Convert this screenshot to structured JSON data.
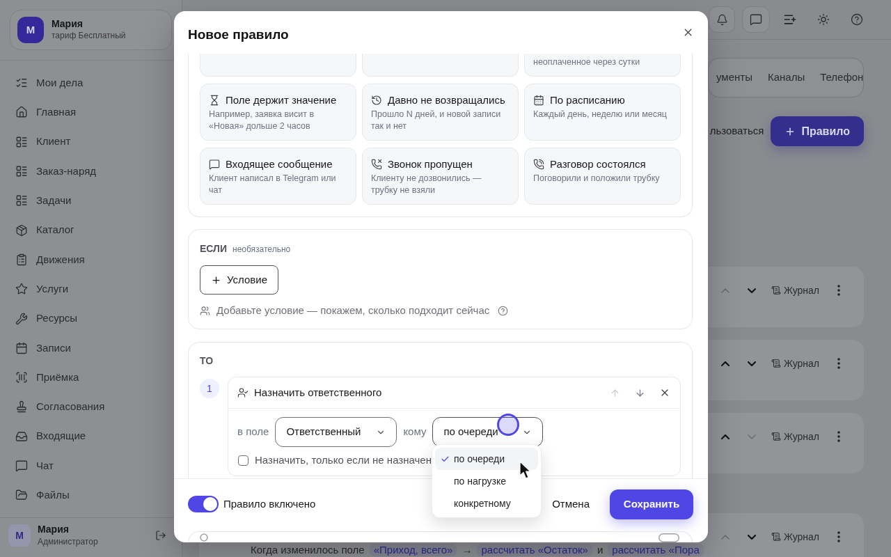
{
  "sidebar": {
    "profile": {
      "avatar": "M",
      "name": "Мария",
      "plan": "тариф Бесплатный"
    },
    "items": [
      {
        "label": "Мои дела",
        "selected": false
      },
      {
        "label": "Главная",
        "selected": false
      },
      {
        "label": "Клиент",
        "selected": false
      },
      {
        "label": "Заказ-наряд",
        "selected": false
      },
      {
        "label": "Задачи",
        "selected": false
      },
      {
        "label": "Каталог",
        "selected": false
      },
      {
        "label": "Движения",
        "selected": false
      },
      {
        "label": "Услуги",
        "selected": false
      },
      {
        "label": "Ресурсы",
        "selected": false
      },
      {
        "label": "Записи",
        "selected": false
      },
      {
        "label": "Приёмка",
        "selected": false
      },
      {
        "label": "Согласования",
        "selected": false
      },
      {
        "label": "Входящие",
        "selected": false
      },
      {
        "label": "Чат",
        "selected": false
      },
      {
        "label": "Файлы",
        "selected": false
      }
    ],
    "user": {
      "avatar": "M",
      "name": "Мария",
      "role": "Администратор"
    }
  },
  "main": {
    "tabs": [
      {
        "label": "ументы",
        "selected": false
      },
      {
        "label": "Каналы",
        "selected": false
      },
      {
        "label": "Телефон",
        "selected": false
      }
    ],
    "help_link": "льзоваться",
    "add_button": "Правило",
    "rule_groups": [
      {
        "rules": [
          {
            "up_disabled": true,
            "down_disabled": false,
            "log_label": "Журнал"
          },
          {
            "up_disabled": false,
            "down_disabled": false,
            "log_label": "Журнал"
          },
          {
            "up_disabled": false,
            "down_disabled": true,
            "log_label": "Журнал"
          }
        ]
      },
      {
        "rules": [
          {
            "up_disabled": true,
            "down_disabled": false,
            "log_label": "Журнал",
            "description": [
              {
                "kind": "text",
                "text": "Когда изменилось поле"
              },
              {
                "kind": "token",
                "text": "«Приход, всего»"
              },
              {
                "kind": "text",
                "text": "→"
              },
              {
                "kind": "token",
                "text": "рассчитать «Остаток»"
              },
              {
                "kind": "text",
                "text": "и"
              },
              {
                "kind": "token",
                "text": "рассчитать «Пора"
              }
            ]
          }
        ]
      }
    ]
  },
  "modal": {
    "title": "Новое правило",
    "triggers": {
      "clipped_row": [
        {
          "kind": "blank",
          "selected": false
        },
        {
          "kind": "blank",
          "selected": false
        },
        {
          "kind": "text",
          "description": "неоплаченное через сутки",
          "selected": false
        }
      ],
      "cards": [
        {
          "title": "Поле держит значение",
          "description": "Например, заявка висит в «Новая» дольше 2 часов",
          "selected": false
        },
        {
          "title": "Давно не возвращались",
          "description": "Прошло N дней, и новой записи так и нет",
          "selected": false
        },
        {
          "title": "По расписанию",
          "description": "Каждый день, неделю или месяц",
          "selected": false
        },
        {
          "title": "Входящее сообщение",
          "description": "Клиент написал в Telegram или чат",
          "selected": false
        },
        {
          "title": "Звонок пропущен",
          "description": "Клиенту не дозвонились — трубку не взяли",
          "selected": false
        },
        {
          "title": "Разговор состоялся",
          "description": "Поговорили и положили трубку",
          "selected": false
        }
      ]
    },
    "condition": {
      "heading": "ЕСЛИ",
      "note": "необязательно",
      "add_button": "Условие",
      "hint": "Добавьте условие — покажем, сколько подходит сейчас"
    },
    "actions": {
      "heading": "ТО",
      "steps": [
        {
          "number": "1",
          "title": "Назначить ответственного",
          "up_disabled": true,
          "down_disabled": false,
          "field_label": "в поле",
          "field_value": "Ответственный",
          "target_label": "кому",
          "target_value": "по очереди",
          "dropdown_open": true,
          "options": [
            {
              "label": "по очереди",
              "selected": true
            },
            {
              "label": "по нагрузке",
              "selected": false
            },
            {
              "label": "конкретному",
              "selected": false
            }
          ],
          "only_if_unassigned": {
            "label": "Назначить, только если не назначен",
            "checked": false
          }
        }
      ]
    },
    "footer": {
      "enabled": {
        "label": "Правило включено",
        "on": true
      },
      "cancel": "Отмена",
      "save": "Сохранить"
    }
  }
}
